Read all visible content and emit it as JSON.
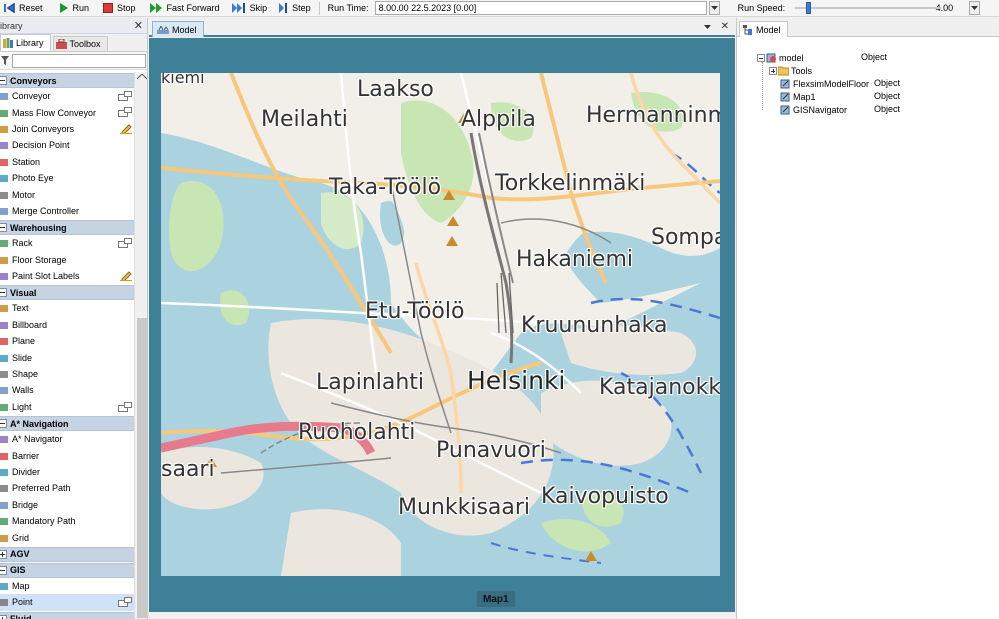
{
  "toolbar": {
    "reset": "Reset",
    "run": "Run",
    "stop": "Stop",
    "fast_forward": "Fast Forward",
    "skip": "Skip",
    "step": "Step",
    "run_time_label": "Run Time:",
    "run_time_value": "8.00.00  22.5.2023  [0.00]",
    "run_speed_label": "Run Speed:",
    "run_speed_value": "4.00",
    "run_speed_level": 0.09
  },
  "library": {
    "title": "ibrary",
    "tabs": [
      "Library",
      "Toolbox"
    ],
    "search_value": "",
    "categories": [
      {
        "name": "Conveyors",
        "items": [
          "Conveyor",
          "Mass Flow Conveyor",
          "Join Conveyors",
          "Decision Point",
          "Station",
          "Photo Eye",
          "Motor",
          "Merge Controller"
        ]
      },
      {
        "name": "Warehousing",
        "items": [
          "Rack",
          "Floor Storage",
          "Paint Slot Labels"
        ]
      },
      {
        "name": "Visual",
        "items": [
          "Text",
          "Billboard",
          "Plane",
          "Slide",
          "Shape",
          "Walls",
          "Light"
        ]
      },
      {
        "name": "A* Navigation",
        "items": [
          "A* Navigator",
          "Barrier",
          "Divider",
          "Preferred Path",
          "Bridge",
          "Mandatory Path",
          "Grid"
        ]
      },
      {
        "name": "AGV",
        "items": []
      },
      {
        "name": "GIS",
        "items": [
          "Map",
          "Point"
        ]
      },
      {
        "name": "Fluid",
        "items": []
      }
    ]
  },
  "view": {
    "tab_label": "Model",
    "map_caption": "Map1",
    "places": {
      "laakso": "Laakso",
      "meilahti": "Meilahti",
      "alppila": "Alppila",
      "hermanninmaki": "Hermanninmäki",
      "taka_toolo": "Taka-Töölö",
      "torkkelinmaki": "Torkkelinmäki",
      "sompasaari": "Sompasa",
      "hakaniemi": "Hakaniemi",
      "etu_toolo": "Etu-Töölö",
      "kruununhaka": "Kruununhaka",
      "lapinlahti": "Lapinlahti",
      "helsinki": "Helsinki",
      "katajanokka": "Katajanokka",
      "ruoholahti": "Ruoholahti",
      "punavuori": "Punavuori",
      "saari": "saari",
      "kaivopuisto": "Kaivopuisto",
      "munkkisaari": "Munkkisaari",
      "kiemi": "kiemi"
    }
  },
  "model_tree": {
    "tab_label": "Model",
    "root": {
      "name": "model",
      "type": "Object"
    },
    "children": [
      {
        "name": "Tools",
        "type": ""
      },
      {
        "name": "FlexsimModelFloor",
        "type": "Object"
      },
      {
        "name": "Map1",
        "type": "Object"
      },
      {
        "name": "GISNavigator",
        "type": "Object"
      }
    ]
  },
  "colors": {
    "accent": "#3e8098",
    "category_header": "#c6d3e3",
    "water": "#aad3df",
    "park": "#c8e6b4",
    "major_road": "#f7c77b",
    "railway": "#e87a8d"
  }
}
